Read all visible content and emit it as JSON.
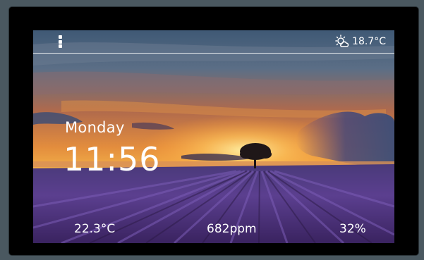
{
  "statusbar": {
    "menu_icon": "kebab-menu-icon",
    "weather_icon": "partly-sunny-icon",
    "outdoor_temp": "18.7°C"
  },
  "main": {
    "day": "Monday",
    "time": "11:56"
  },
  "sensors": {
    "temperature": "22.3°C",
    "co2": "682ppm",
    "humidity": "32%"
  },
  "colors": {
    "bezel": "#000000",
    "wall": "#4a5860",
    "text": "#ffffff",
    "sunset": "#f4a43a",
    "lavender": "#5b3f8f"
  }
}
